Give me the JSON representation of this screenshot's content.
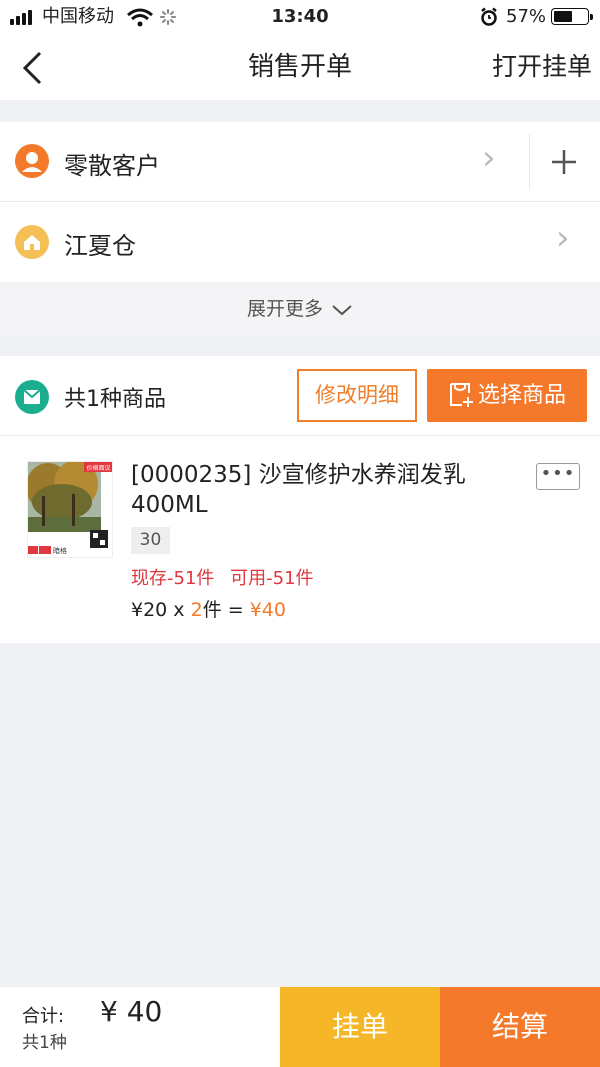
{
  "status": {
    "carrier": "中国移动",
    "time": "13:40",
    "battery": "57%",
    "battery_level": 0.57
  },
  "nav": {
    "title": "销售开单",
    "right": "打开挂单"
  },
  "customer": {
    "label": "零散客户"
  },
  "warehouse": {
    "label": "江夏仓"
  },
  "expand": {
    "label": "展开更多"
  },
  "goods": {
    "count_label": "共1种商品",
    "edit_button": "修改明细",
    "select_button": "选择商品"
  },
  "product": {
    "name": "[0000235] 沙宣修护水养润发乳400ML",
    "code": "30",
    "stock": "现存-51件",
    "available": "可用-51件",
    "unit_price": "¥20",
    "times": " x ",
    "qty": "2",
    "unit": "件",
    "equals": " = ",
    "subtotal": "¥40",
    "thumb_tag": "价格面议",
    "thumb_label": "暗格"
  },
  "footer": {
    "total_label": "合计:",
    "total_value": "¥ 40",
    "count": "共1种",
    "hang_button": "挂单",
    "settle_button": "结算"
  },
  "colors": {
    "accent": "#f5792b",
    "hang": "#f5b628",
    "stock_red": "#e0383e",
    "customer_icon": "#f5792b",
    "warehouse_icon": "#f4c056",
    "goods_icon": "#1aae8f"
  }
}
